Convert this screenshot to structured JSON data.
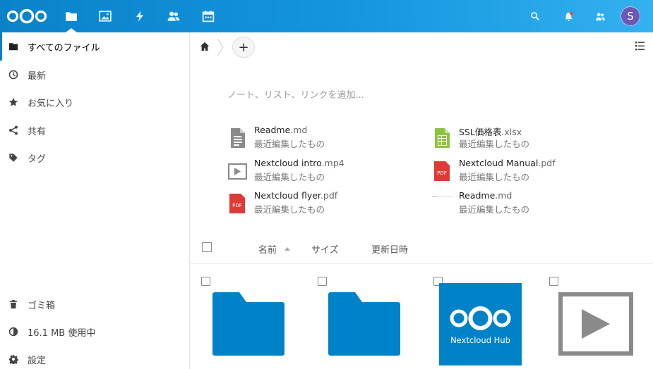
{
  "header": {
    "apps": [
      {
        "name": "files-icon",
        "active": true
      },
      {
        "name": "photos-icon",
        "active": false
      },
      {
        "name": "activity-icon",
        "active": false
      },
      {
        "name": "contacts-icon",
        "active": false
      },
      {
        "name": "calendar-icon",
        "active": false
      }
    ],
    "right_icons": [
      "search-icon",
      "notifications-icon",
      "contacts-menu-icon"
    ],
    "avatar_initial": "S",
    "colors": {
      "header_start": "#0a82c9",
      "header_end": "#33b1f0",
      "avatar": "#6a59b6"
    }
  },
  "sidebar": {
    "items": [
      {
        "label": "すべてのファイル",
        "icon": "folder-icon",
        "active": true
      },
      {
        "label": "最新",
        "icon": "clock-icon",
        "active": false
      },
      {
        "label": "お気に入り",
        "icon": "star-icon",
        "active": false
      },
      {
        "label": "共有",
        "icon": "share-icon",
        "active": false
      },
      {
        "label": "タグ",
        "icon": "tag-icon",
        "active": false
      }
    ],
    "bottom": {
      "trash": "ゴミ箱",
      "quota": "16.1 MB 使用中",
      "settings": "設定"
    }
  },
  "breadcrumb": {
    "home_icon": "home-icon",
    "add_label": "+"
  },
  "note_placeholder": "ノート、リスト、リンクを追加...",
  "recent": [
    {
      "base": "Readme",
      "ext": ".md",
      "sub": "最近編集したもの",
      "icon": "document-icon"
    },
    {
      "base": "SSL価格表",
      "ext": ".xlsx",
      "sub": "最近編集したもの",
      "icon": "spreadsheet-icon"
    },
    {
      "base": "Nextcloud intro",
      "ext": ".mp4",
      "sub": "最近編集したもの",
      "icon": "video-icon"
    },
    {
      "base": "Nextcloud Manual",
      "ext": ".pdf",
      "sub": "最近編集したもの",
      "icon": "pdf-icon"
    },
    {
      "base": "Nextcloud flyer",
      "ext": ".pdf",
      "sub": "最近編集したもの",
      "icon": "pdf-icon"
    },
    {
      "base": "Readme",
      "ext": ".md",
      "sub": "最近編集したもの",
      "icon": "text-preview-icon"
    }
  ],
  "pdf_badge": "PDF",
  "list_header": {
    "name": "名前",
    "size": "サイズ",
    "modified": "更新日時"
  },
  "grid": {
    "hub_label": "Nextcloud Hub",
    "colors": {
      "folder": "#0082c9",
      "accent": "#0082c9"
    }
  }
}
